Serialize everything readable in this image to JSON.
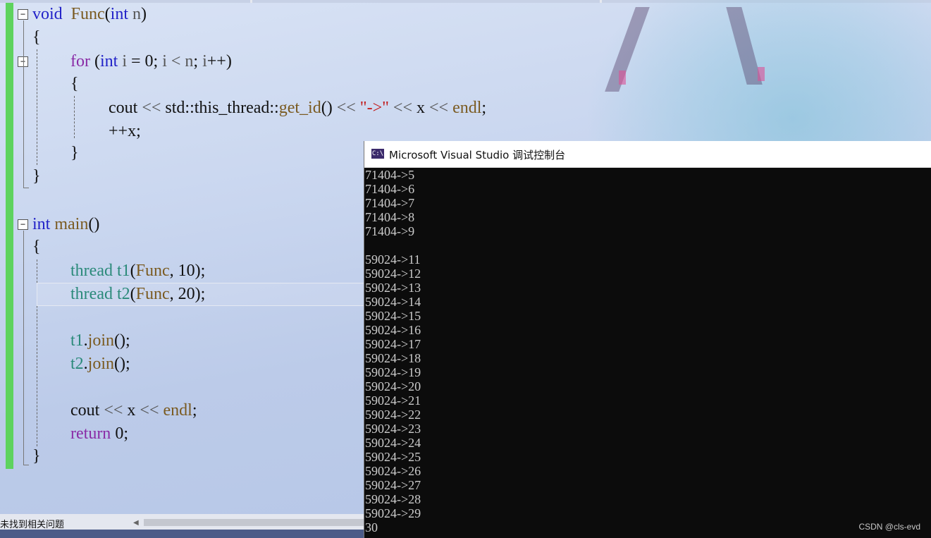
{
  "editor": {
    "lines": [
      {
        "id": "l1",
        "tokens": [
          [
            "kw",
            "void"
          ],
          [
            "",
            "  "
          ],
          [
            "fn",
            "Func"
          ],
          [
            "",
            "("
          ],
          [
            "kw",
            "int"
          ],
          [
            "",
            ""
          ],
          [
            "pm",
            " n"
          ],
          [
            "",
            ")"
          ]
        ]
      },
      {
        "id": "l2",
        "tokens": [
          [
            "",
            "{"
          ]
        ]
      },
      {
        "id": "l3",
        "tokens": [
          [
            "kw2",
            "for"
          ],
          [
            "",
            " ("
          ],
          [
            "kw",
            "int"
          ],
          [
            "",
            " "
          ],
          [
            "pm",
            "i"
          ],
          [
            "",
            " = 0; "
          ],
          [
            "pm",
            "i"
          ],
          [
            "",
            " "
          ],
          [
            "op",
            "<"
          ],
          [
            "",
            " "
          ],
          [
            "pm",
            "n"
          ],
          [
            "",
            "; "
          ],
          [
            "pm",
            "i"
          ],
          [
            "",
            "++)"
          ]
        ]
      },
      {
        "id": "l4",
        "tokens": [
          [
            "",
            "{"
          ]
        ]
      },
      {
        "id": "l5",
        "tokens": [
          [
            "",
            "cout "
          ],
          [
            "op",
            "<<"
          ],
          [
            "",
            " std::this_thread::"
          ],
          [
            "fn",
            "get_id"
          ],
          [
            "",
            "() "
          ],
          [
            "op",
            "<<"
          ],
          [
            "",
            " "
          ],
          [
            "str",
            "\"->\""
          ],
          [
            "",
            " "
          ],
          [
            "op",
            "<<"
          ],
          [
            "",
            " x "
          ],
          [
            "op",
            "<<"
          ],
          [
            "",
            " "
          ],
          [
            "fn",
            "endl"
          ],
          [
            ";"
          ]
        ]
      },
      {
        "id": "l6",
        "tokens": [
          [
            "",
            "++x;"
          ]
        ]
      },
      {
        "id": "l7",
        "tokens": [
          [
            "",
            "}"
          ]
        ]
      },
      {
        "id": "l8",
        "tokens": [
          [
            "",
            "}"
          ]
        ]
      },
      {
        "id": "l9",
        "tokens": [
          [
            "kw",
            "int"
          ],
          [
            "",
            " "
          ],
          [
            "fn",
            "main"
          ],
          [
            "",
            "()"
          ]
        ]
      },
      {
        "id": "l10",
        "tokens": [
          [
            "",
            "{"
          ]
        ]
      },
      {
        "id": "l11",
        "tokens": [
          [
            "ty",
            "thread"
          ],
          [
            "",
            " "
          ],
          [
            "ty",
            "t1"
          ],
          [
            "",
            "("
          ],
          [
            "fn",
            "Func"
          ],
          [
            "",
            ", 10);"
          ]
        ]
      },
      {
        "id": "l12",
        "tokens": [
          [
            "ty",
            "thread"
          ],
          [
            "",
            " "
          ],
          [
            "ty",
            "t2"
          ],
          [
            "",
            "("
          ],
          [
            "fn",
            "Func"
          ],
          [
            "",
            ", 20);"
          ]
        ]
      },
      {
        "id": "l13",
        "tokens": [
          [
            "ty",
            "t1"
          ],
          [
            ".",
            ""
          ],
          [
            "fn",
            "join"
          ],
          [
            "",
            "();"
          ]
        ]
      },
      {
        "id": "l14",
        "tokens": [
          [
            "ty",
            "t2"
          ],
          [
            ".",
            ""
          ],
          [
            "fn",
            "join"
          ],
          [
            "",
            "();"
          ]
        ]
      },
      {
        "id": "l15",
        "tokens": [
          [
            "",
            "cout "
          ],
          [
            "op",
            "<<"
          ],
          [
            "",
            " x "
          ],
          [
            "op",
            "<<"
          ],
          [
            "",
            " "
          ],
          [
            "fn",
            "endl"
          ],
          [
            ";"
          ]
        ]
      },
      {
        "id": "l16",
        "tokens": [
          [
            "kw2",
            "return"
          ],
          [
            "",
            " 0;"
          ]
        ]
      },
      {
        "id": "l17",
        "tokens": [
          [
            "",
            "}"
          ]
        ]
      }
    ],
    "fold_glyph": "−"
  },
  "statusbar": {
    "left_text": "未找到相关问题",
    "scroll_left_arrow": "◀"
  },
  "console": {
    "icon_text": "C:\\",
    "title": "Microsoft Visual Studio 调试控制台",
    "output": [
      "71404->5",
      "71404->6",
      "71404->7",
      "71404->8",
      "71404->9",
      "",
      "59024->11",
      "59024->12",
      "59024->13",
      "59024->14",
      "59024->15",
      "59024->16",
      "59024->17",
      "59024->18",
      "59024->19",
      "59024->20",
      "59024->21",
      "59024->22",
      "59024->23",
      "59024->24",
      "59024->25",
      "59024->26",
      "59024->27",
      "59024->28",
      "59024->29",
      "30"
    ],
    "watermark": "CSDN @cls-evd"
  }
}
